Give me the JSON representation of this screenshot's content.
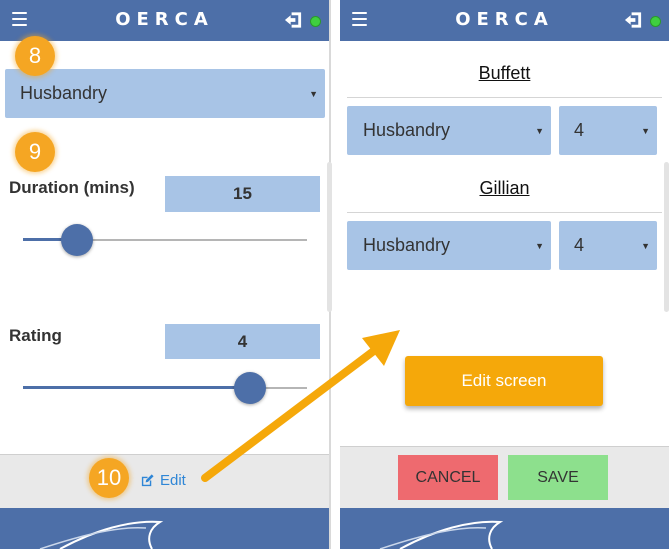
{
  "app": {
    "logo_text": "OERCA"
  },
  "colors": {
    "header_blue": "#4d6fa8",
    "select_blue": "#a8c4e6",
    "callout_orange": "#f5a623",
    "edit_screen_orange": "#f5a80a",
    "cancel_red": "#ee6a6f",
    "save_green": "#8de08d",
    "status_green": "#3fcf3f",
    "link_blue": "#2f86d6"
  },
  "icons": {
    "menu": "hamburger-menu-icon",
    "logout": "sign-out-icon",
    "status": "online-status-dot",
    "edit": "edit-pencil-square-icon",
    "caret": "dropdown-caret-icon"
  },
  "left": {
    "callouts": [
      "8",
      "9",
      "10"
    ],
    "activity_select": {
      "value": "Husbandry"
    },
    "duration": {
      "label": "Duration (mins)",
      "value": "15",
      "slider_fraction": 0.19
    },
    "rating": {
      "label": "Rating",
      "value": "4",
      "slider_fraction": 0.8
    },
    "edit_link": {
      "label": "Edit"
    }
  },
  "right": {
    "animals": [
      {
        "name": "Buffett",
        "activity": "Husbandry",
        "rating": "4"
      },
      {
        "name": "Gillian",
        "activity": "Husbandry",
        "rating": "4"
      }
    ],
    "edit_screen_button": {
      "label": "Edit screen"
    },
    "cancel_button": {
      "label": "CANCEL"
    },
    "save_button": {
      "label": "SAVE"
    }
  }
}
